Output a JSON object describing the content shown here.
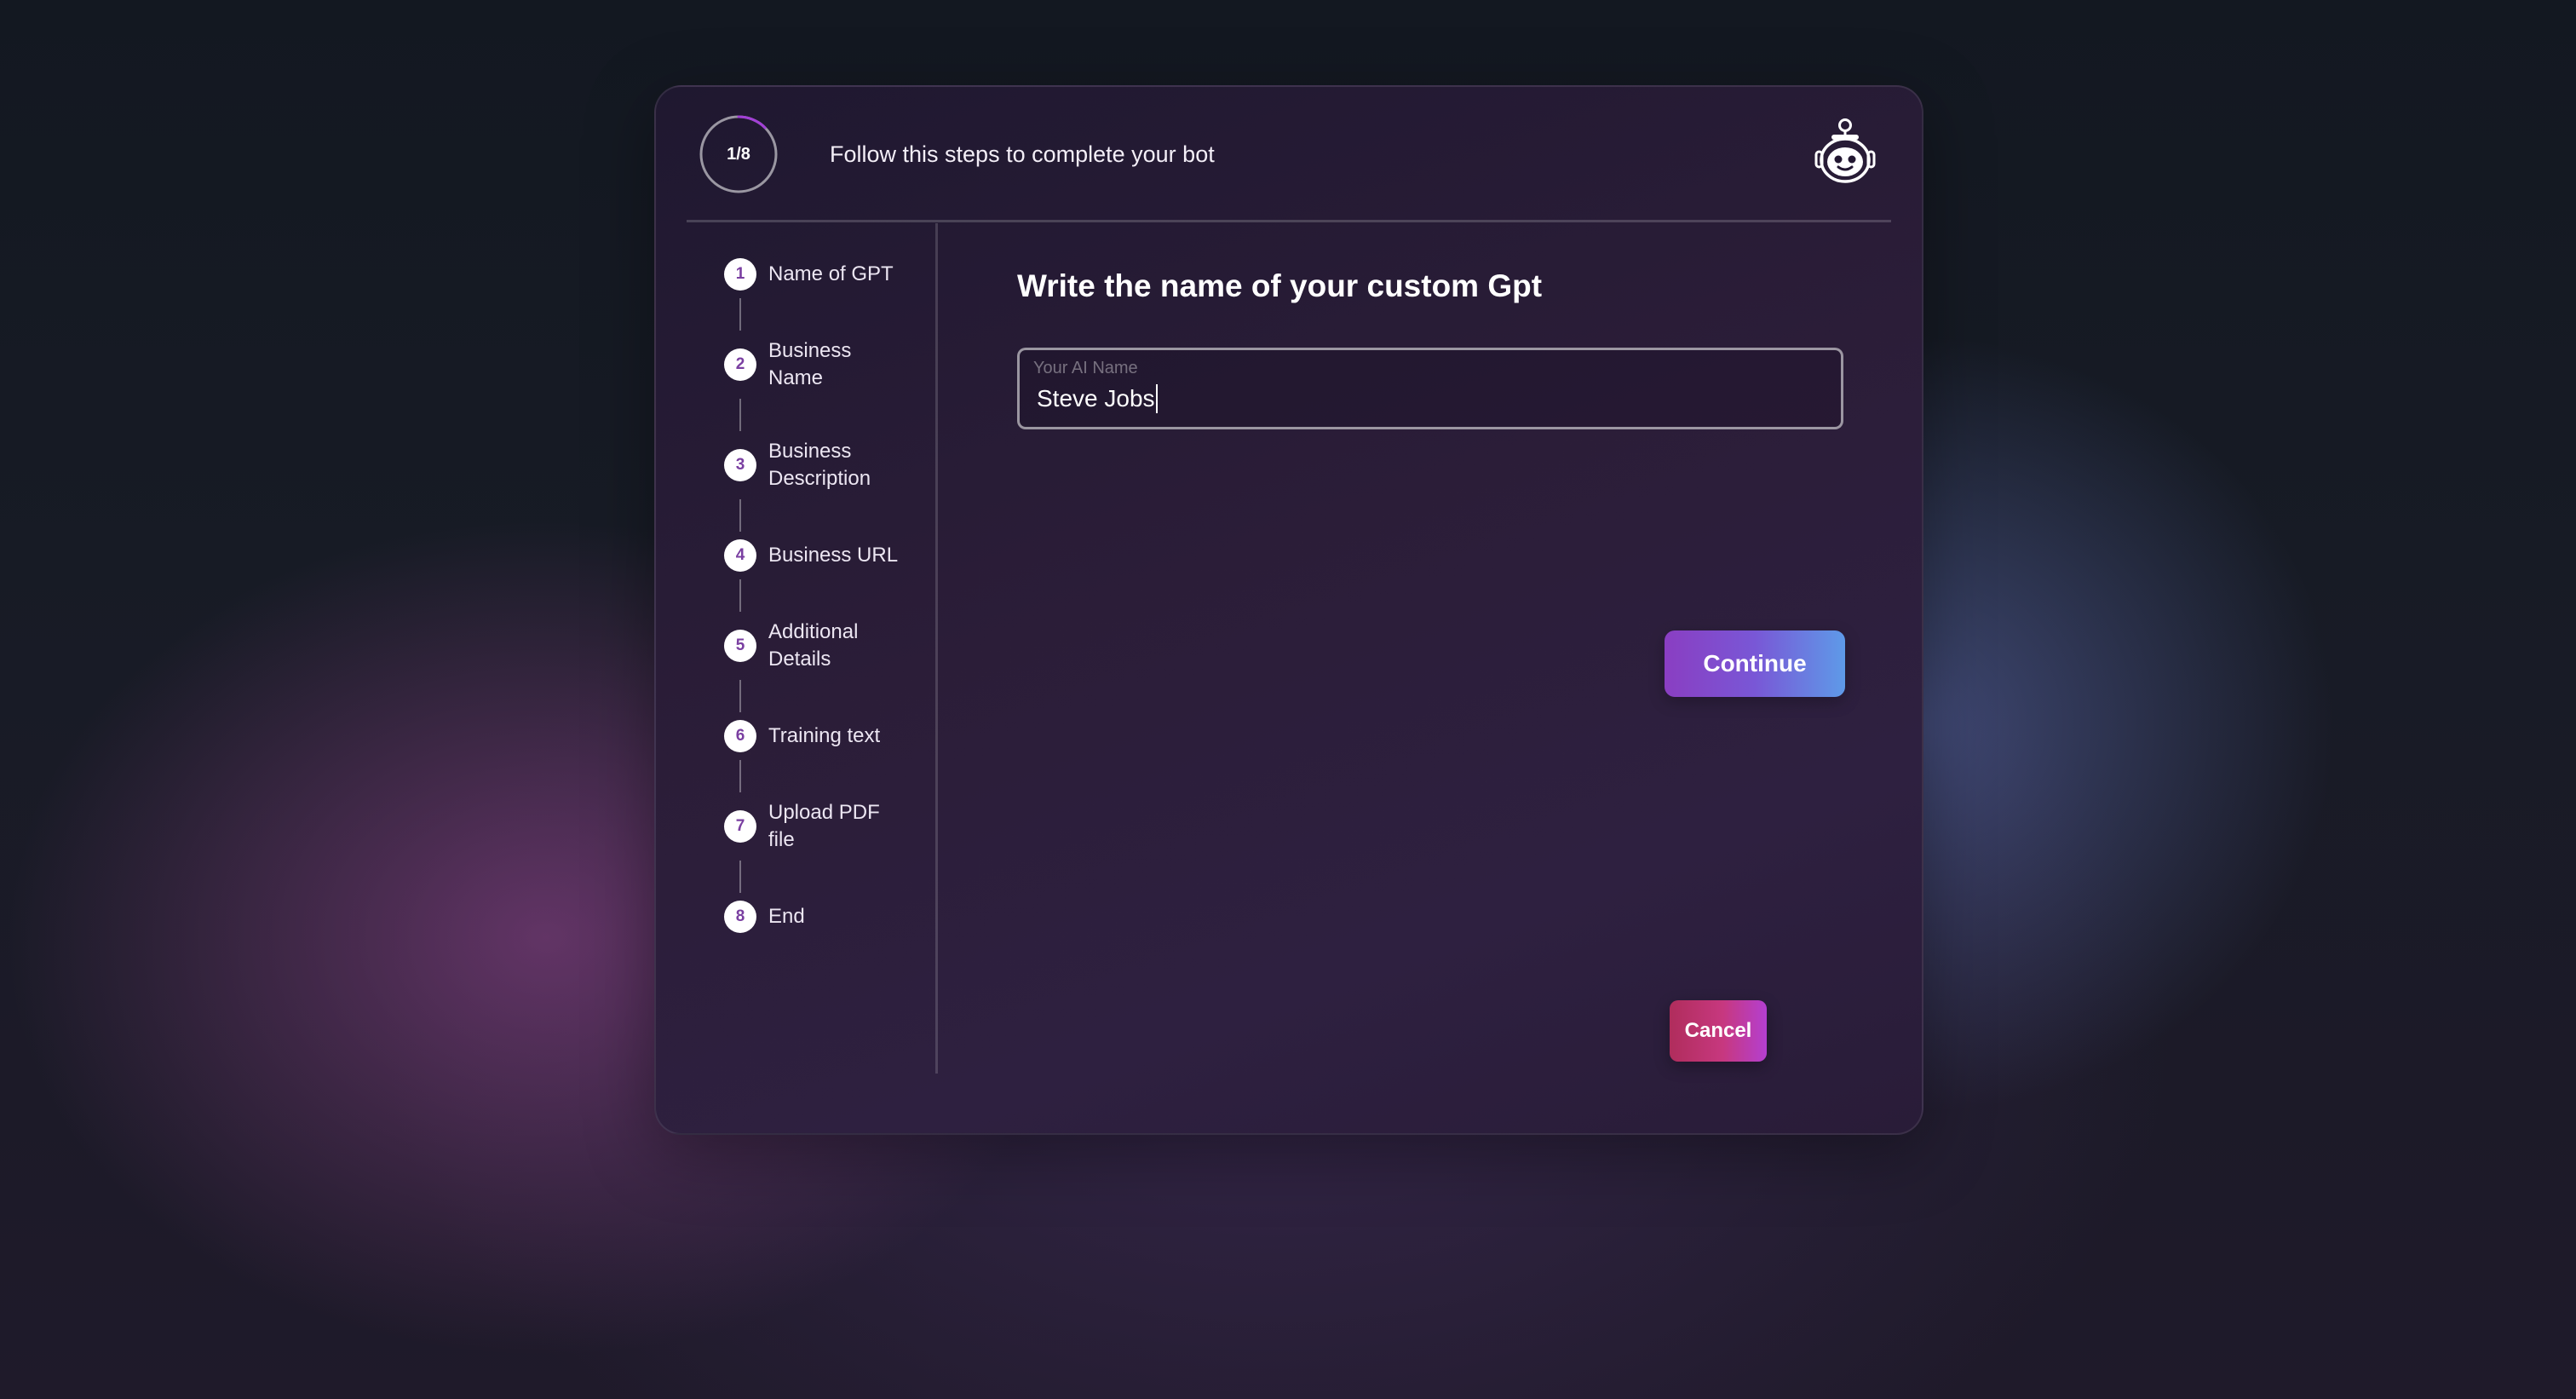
{
  "header": {
    "progress_label": "1/8",
    "progress_fraction": 0.125,
    "title": "Follow this steps to complete your bot",
    "bot_icon": "robot-icon"
  },
  "steps": [
    {
      "number": "1",
      "label": "Name of GPT"
    },
    {
      "number": "2",
      "label": "Business Name"
    },
    {
      "number": "3",
      "label": "Business Description"
    },
    {
      "number": "4",
      "label": "Business URL"
    },
    {
      "number": "5",
      "label": "Additional Details"
    },
    {
      "number": "6",
      "label": "Training text"
    },
    {
      "number": "7",
      "label": "Upload PDF file"
    },
    {
      "number": "8",
      "label": "End"
    }
  ],
  "main": {
    "heading": "Write the name of your custom Gpt",
    "ai_name_field": {
      "label": "Your AI Name",
      "value": "Steve Jobs"
    },
    "continue_label": "Continue",
    "cancel_label": "Cancel"
  },
  "colors": {
    "accent_purple": "#8a3ec2",
    "accent_blue": "#5e9ae8",
    "cancel_red": "#b02d5c",
    "step_number": "#7a3fa1"
  }
}
